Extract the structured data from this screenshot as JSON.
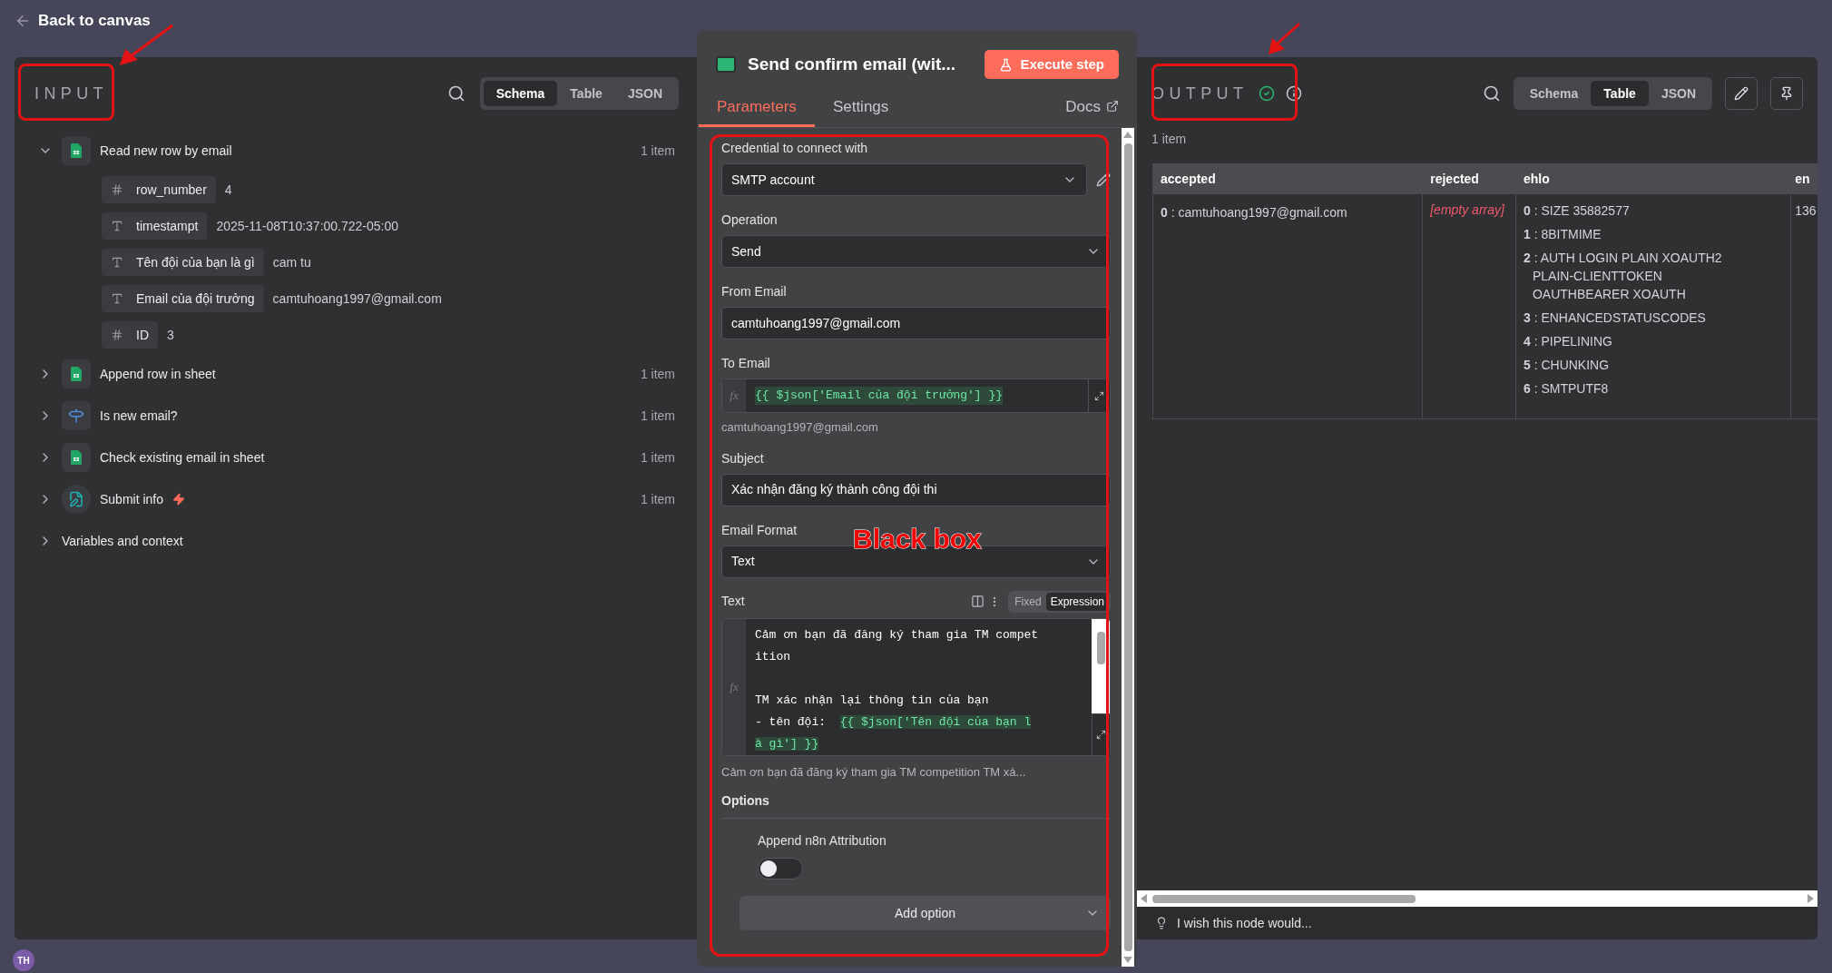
{
  "back_link": "Back to canvas",
  "annotation_label": "Black box",
  "avatar": "TH",
  "input": {
    "title": "INPUT",
    "view_tabs": [
      {
        "label": "Schema",
        "selected": true
      },
      {
        "label": "Table",
        "selected": false
      },
      {
        "label": "JSON",
        "selected": false
      }
    ],
    "nodes": [
      {
        "name": "Read new row by email",
        "kind": "sheet",
        "count": "1 item",
        "expanded": true,
        "trigger": false,
        "fields": [
          {
            "kind": "number",
            "name": "row_number",
            "value": "4"
          },
          {
            "kind": "string",
            "name": "timestampt",
            "value": "2025-11-08T10:37:00.722-05:00"
          },
          {
            "kind": "string",
            "name": "Tên đội của bạn là gì",
            "value": "cam tu"
          },
          {
            "kind": "string",
            "name": "Email của đội trưởng",
            "value": "camtuhoang1997@gmail.com"
          },
          {
            "kind": "number",
            "name": "ID",
            "value": "3"
          }
        ]
      },
      {
        "name": "Append row in sheet",
        "kind": "sheet",
        "count": "1 item",
        "expanded": false,
        "trigger": false
      },
      {
        "name": "Is new email?",
        "kind": "switch",
        "count": "1 item",
        "expanded": false,
        "trigger": false
      },
      {
        "name": "Check existing email in sheet",
        "kind": "sheet",
        "count": "1 item",
        "expanded": false,
        "trigger": false
      },
      {
        "name": "Submit info",
        "kind": "form",
        "count": "1 item",
        "expanded": false,
        "trigger": true
      }
    ],
    "variables": {
      "label": "Variables and context",
      "expanded": false
    }
  },
  "node": {
    "title": "Send confirm email (wit...",
    "execute": "Execute step",
    "tabs": [
      {
        "label": "Parameters",
        "selected": true
      },
      {
        "label": "Settings",
        "selected": false
      }
    ],
    "docs": "Docs",
    "credential": {
      "label": "Credential to connect with",
      "value": "SMTP account"
    },
    "operation": {
      "label": "Operation",
      "value": "Send"
    },
    "from_email": {
      "label": "From Email",
      "value": "camtuhoang1997@gmail.com"
    },
    "to_email": {
      "label": "To Email",
      "fx": "fx",
      "expression": "{{ $json['Email của đội trưởng'] }}",
      "result": "camtuhoang1997@gmail.com"
    },
    "subject": {
      "label": "Subject",
      "value": "Xác nhận đăng ký thành công đội thi"
    },
    "email_format": {
      "label": "Email Format",
      "value": "Text"
    },
    "text": {
      "label": "Text",
      "fx": "fx",
      "modes": [
        {
          "label": "Fixed",
          "selected": false
        },
        {
          "label": "Expression",
          "selected": true
        }
      ],
      "paragraphs": [
        {
          "lines": [
            {
              "segments": [
                {
                  "text": "Cảm ơn bạn đã đăng ký tham gia TM compet",
                  "expr": false
                }
              ]
            },
            {
              "segments": [
                {
                  "text": "ition",
                  "expr": false
                }
              ]
            }
          ]
        },
        {
          "lines": [
            {
              "segments": [
                {
                  "text": "TM xác nhận lại thông tin của bạn",
                  "expr": false
                }
              ]
            },
            {
              "segments": [
                {
                  "text": "- tên đội:  ",
                  "expr": false
                },
                {
                  "text": "{{ $json['Tên đội của bạn l",
                  "expr": true
                }
              ]
            },
            {
              "segments": [
                {
                  "text": "à gì'] }}",
                  "expr": true
                }
              ]
            }
          ]
        }
      ],
      "result": "Cảm ơn bạn đã đăng ký tham gia TM competition TM xá..."
    },
    "options": {
      "title": "Options",
      "items": [
        {
          "label": "Append n8n Attribution",
          "on": false
        }
      ],
      "add_button": "Add option"
    }
  },
  "output": {
    "title": "OUTPUT",
    "success": true,
    "view_tabs": [
      {
        "label": "Schema",
        "selected": false
      },
      {
        "label": "Table",
        "selected": true
      },
      {
        "label": "JSON",
        "selected": false
      }
    ],
    "count": "1 item",
    "columns": [
      "accepted",
      "rejected",
      "ehlo",
      "en"
    ],
    "row": {
      "accepted": [
        "**0** : camtuhoang1997@gmail.com"
      ],
      "rejected": "[empty array]",
      "ehlo": [
        "**0** : SIZE 35882577",
        "**1** : 8BITMIME",
        "**2** : AUTH LOGIN PLAIN XOAUTH2 PLAIN-CLIENTTOKEN OAUTHBEARER XOAUTH",
        "**3** : ENHANCEDSTATUSCODES",
        "**4** : PIPELINING",
        "**5** : CHUNKING",
        "**6** : SMTPUTF8"
      ],
      "column_4": "136"
    },
    "feedback": "I wish this node would..."
  }
}
